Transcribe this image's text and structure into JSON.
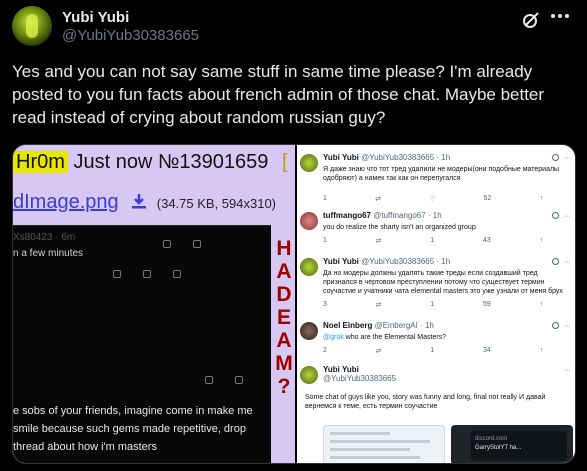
{
  "author": {
    "name": "Yubi Yubi",
    "handle": "@YubiYub30383665"
  },
  "icons": {
    "grok": "grok-icon",
    "more": "more-icon",
    "download": "download-icon"
  },
  "tweet_text": "Yes and you can not say same stuff in same time please? I'm already posted to you fun facts about french admin of those chat. Maybe better read instead of crying about random russian guy?",
  "media": {
    "left": {
      "poster": "Hr0m",
      "post_info": "Just now №13901659",
      "bracket": "[",
      "file_link": "dImage.png",
      "file_meta": "(34.75 KB, 594x310)",
      "dark": {
        "handle": "Xs80423 · 6m",
        "line1": "n a few minutes",
        "text": "e sobs of your friends, imagine come in make me smile because such gems made repetitive, drop thread about how i'm masters"
      },
      "vertical_text": [
        "H",
        "A",
        "D",
        "E",
        "A",
        "M",
        "?"
      ]
    },
    "right": {
      "tweets": [
        {
          "name": "Yubi Yubi",
          "meta": "@YubiYub30383665 · 1h",
          "text": "Я даже знаю что тот тред удалили не модеры(они подобные материалы одобряют) а намек так как он перепугался",
          "actions": [
            "1",
            "",
            "",
            "52",
            ""
          ]
        },
        {
          "name": "tuffmango67",
          "meta": "@tuffmango67 · 1h",
          "text": "you do realize the sharty isn't an organized group",
          "actions": [
            "1",
            "",
            "1",
            "43",
            ""
          ]
        },
        {
          "name": "Yubi Yubi",
          "meta": "@YubiYub30383665 · 1h",
          "text": "Да но модеры должны удалять такие треды если создавший тред признался в чертовом преступлении потому что существует термин соучастие и учатники чата elemental masters это уже узнали от меня брух",
          "actions": [
            "3",
            "",
            "1",
            "59",
            ""
          ]
        },
        {
          "name": "Noel Einberg",
          "meta": "@EinbergAI · 1h",
          "text_prefix": "@grok",
          "text": " who are the Elemental Masters?",
          "actions": [
            "2",
            "",
            "1",
            "34",
            ""
          ]
        },
        {
          "name": "Yubi Yubi",
          "meta": "@YubiYub30383665",
          "text": "Some chat of guys like you, story was funny and long, final not really И давай вернемся к теме, есть термин соучастие",
          "actions": []
        }
      ],
      "mini_card": {
        "line1": "discord.com",
        "line2": "GarryStolYT ha..."
      }
    }
  }
}
